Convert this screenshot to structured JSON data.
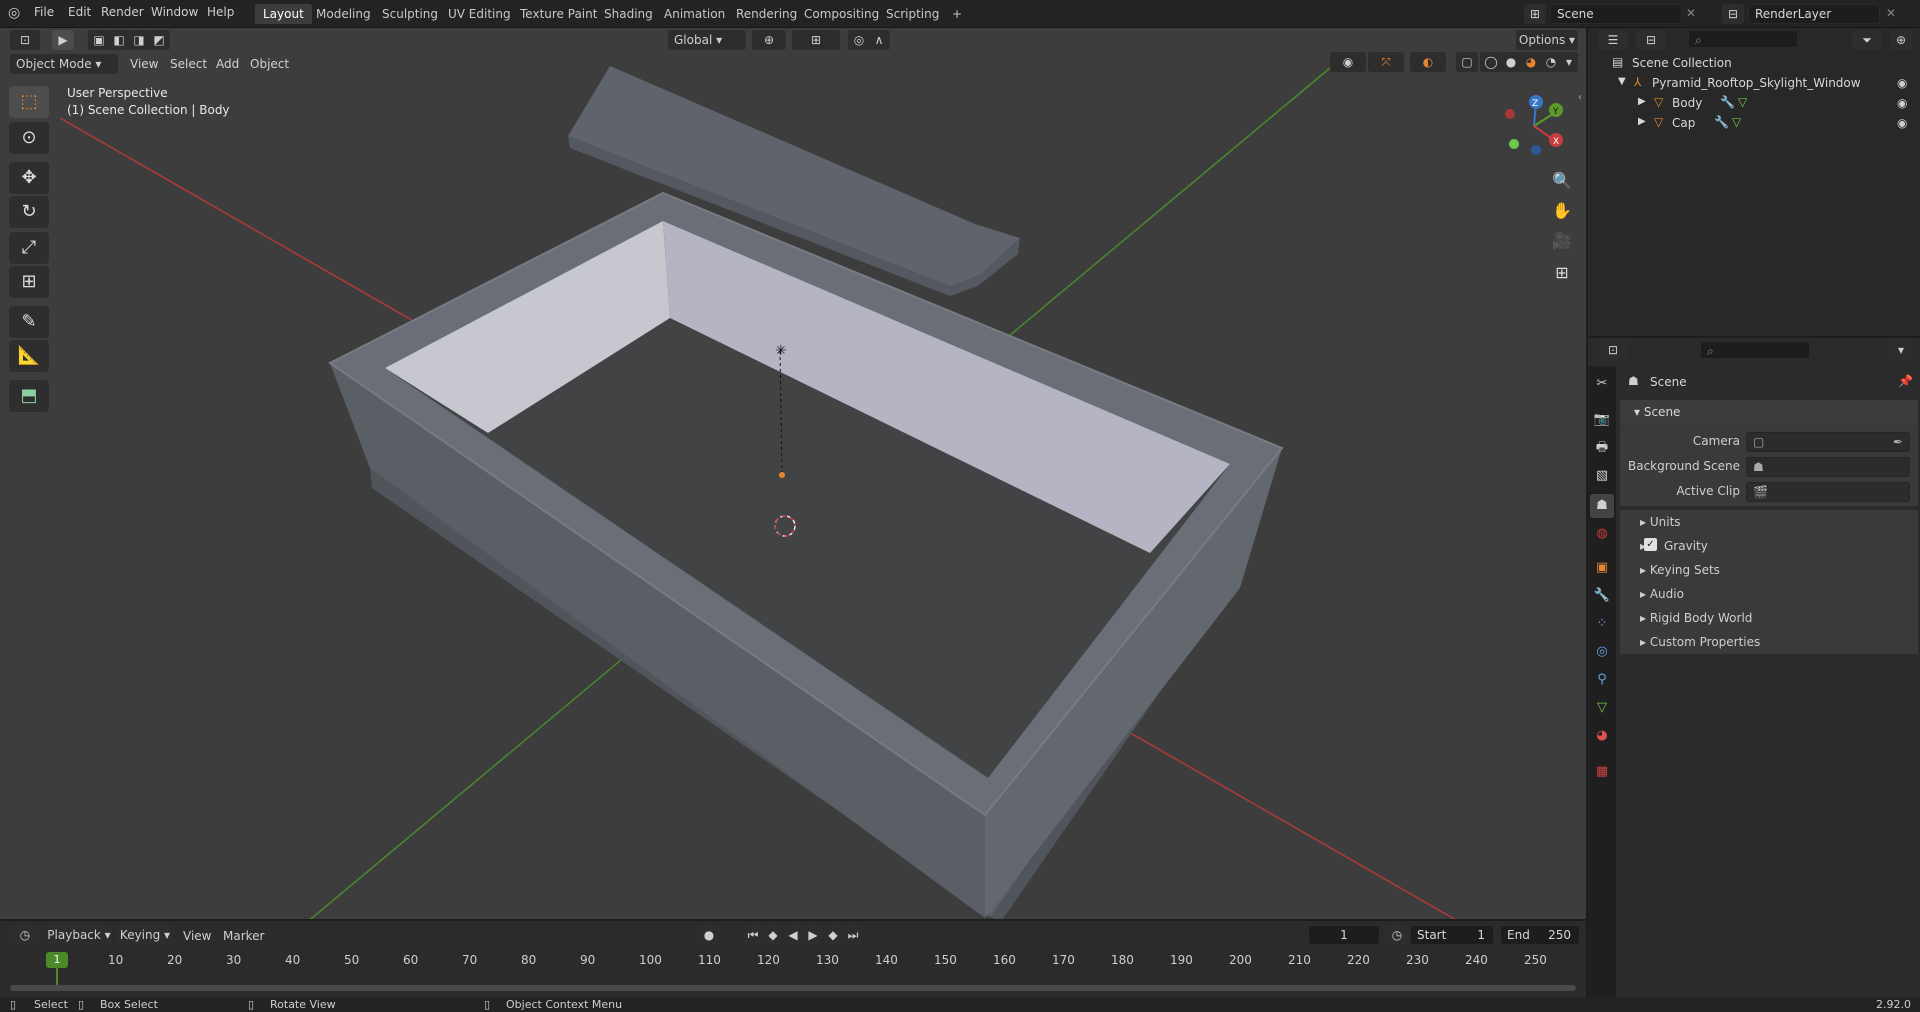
{
  "topbar": {
    "menus": [
      "File",
      "Edit",
      "Render",
      "Window",
      "Help"
    ],
    "workspaces": [
      "Layout",
      "Modeling",
      "Sculpting",
      "UV Editing",
      "Texture Paint",
      "Shading",
      "Animation",
      "Rendering",
      "Compositing",
      "Scripting"
    ],
    "active_workspace": "Layout",
    "add_tab": "+",
    "scene_name": "Scene",
    "render_layer": "RenderLayer"
  },
  "viewport": {
    "mode": "Object Mode",
    "menus": [
      "View",
      "Select",
      "Add",
      "Object"
    ],
    "transform_orientation": "Global",
    "options_label": "Options",
    "overlay_line1": "User Perspective",
    "overlay_line2": "(1) Scene Collection | Body",
    "gizmo": {
      "z": "Z",
      "y": "Y",
      "x": "X"
    }
  },
  "outliner": {
    "root": "Scene Collection",
    "items": [
      {
        "name": "Pyramid_Rooftop_Skylight_Window",
        "depth": 1
      },
      {
        "name": "Body",
        "depth": 2
      },
      {
        "name": "Cap",
        "depth": 2
      }
    ]
  },
  "properties": {
    "context": "Scene",
    "panel": "Scene",
    "fields": [
      {
        "label": "Camera"
      },
      {
        "label": "Background Scene"
      },
      {
        "label": "Active Clip"
      }
    ],
    "subpanels": [
      "Units",
      "Gravity",
      "Keying Sets",
      "Audio",
      "Rigid Body World",
      "Custom Properties"
    ],
    "gravity_checked": true
  },
  "timeline": {
    "menus": [
      "Playback",
      "Keying",
      "View",
      "Marker"
    ],
    "current_frame": "1",
    "start_label": "Start",
    "start": "1",
    "end_label": "End",
    "end": "250",
    "ticks": [
      "10",
      "20",
      "30",
      "40",
      "50",
      "60",
      "70",
      "80",
      "90",
      "100",
      "110",
      "120",
      "130",
      "140",
      "150",
      "160",
      "170",
      "180",
      "190",
      "200",
      "210",
      "220",
      "230",
      "240",
      "250"
    ],
    "playhead": "1"
  },
  "statusbar": {
    "select": "Select",
    "box_select": "Box Select",
    "rotate_view": "Rotate View",
    "context_menu": "Object Context Menu",
    "version": "2.92.0"
  },
  "colors": {
    "accent": "#e5862f",
    "x_axis": "#c83c3c",
    "y_axis": "#5a9a2a",
    "z_axis": "#3a76c8"
  }
}
